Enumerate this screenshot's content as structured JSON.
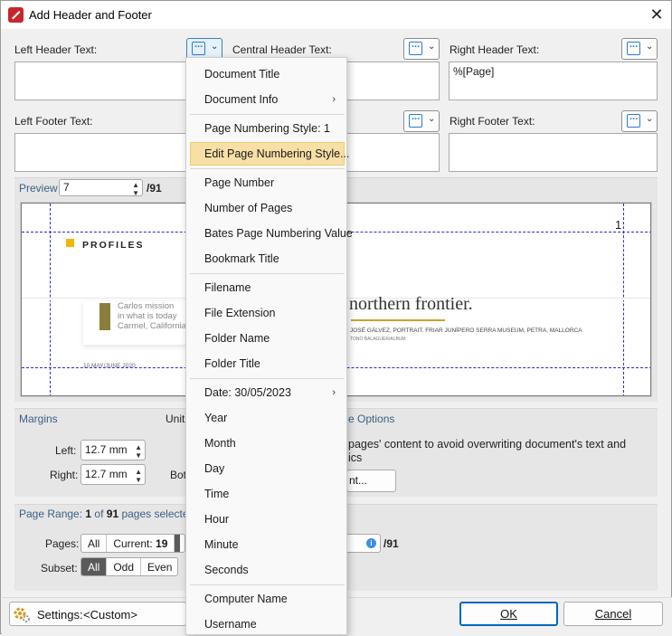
{
  "window": {
    "title": "Add Header and Footer",
    "close": "✕"
  },
  "header": {
    "left_label": "Left Header Text:",
    "central_label": "Central Header Text:",
    "right_label": "Right Header Text:",
    "right_value": "%[Page]"
  },
  "footer": {
    "left_label": "Left Footer Text:",
    "right_label": "Right Footer Text:"
  },
  "preview": {
    "label": "Preview",
    "page_value": "7",
    "total": "/91",
    "page_number": "1",
    "doc_heading": "PROFILES",
    "doc_caption1": "Carlos mission",
    "doc_caption2": "in what is today",
    "doc_caption3": "Carmel, California.",
    "doc_big_text": "northern frontier.",
    "doc_credit": "JOSÉ GÁLVEZ, PORTRAIT. FRIAR JUNÍPERO SERRA MUSEUM, PETRA, MALLORCA",
    "doc_credit_small": "TONO BALAGUER/ALBUM",
    "doc_footer": "10 MAY/JUNE 2020"
  },
  "margins": {
    "title": "Margins",
    "units_label": "Unit",
    "left_label": "Left:",
    "left_value": "12.7 mm",
    "right_label": "Right:",
    "right_value": "12.7 mm",
    "bottom_label": "Bot"
  },
  "options": {
    "title": "e Options",
    "text1": "pages' content to avoid overwriting document's text and",
    "text2": "ics",
    "button_label": "nt..."
  },
  "page_range": {
    "title_prefix": "Page Range: ",
    "current_num": "1",
    "of_text": " of ",
    "total_num": "91",
    "suffix": " pages selected",
    "pages_label": "Pages:",
    "all_label": "All",
    "current_label": "Current:",
    "current_value": "19",
    "subset_label": "Subset:",
    "subset_options": [
      "All",
      "Odd",
      "Even"
    ],
    "range_total": "/91"
  },
  "settings": {
    "label": "Settings:",
    "value": "<Custom>"
  },
  "buttons": {
    "ok": "OK",
    "cancel": "Cancel"
  },
  "menu": {
    "items": [
      "Document Title",
      "Document Info",
      "Page Numbering Style: 1",
      "Edit Page Numbering Style...",
      "Page Number",
      "Number of Pages",
      "Bates Page Numbering Value",
      "Bookmark Title",
      "Filename",
      "File Extension",
      "Folder Name",
      "Folder Title",
      "Date: 30/05/2023",
      "Year",
      "Month",
      "Day",
      "Time",
      "Hour",
      "Minute",
      "Seconds",
      "Computer Name",
      "Username"
    ]
  },
  "colors": {
    "accent": "#0067c0",
    "menu_highlight": "#f7dfa6",
    "guide_lines": "#2a2ad0",
    "doc_accent": "#f2b705"
  }
}
